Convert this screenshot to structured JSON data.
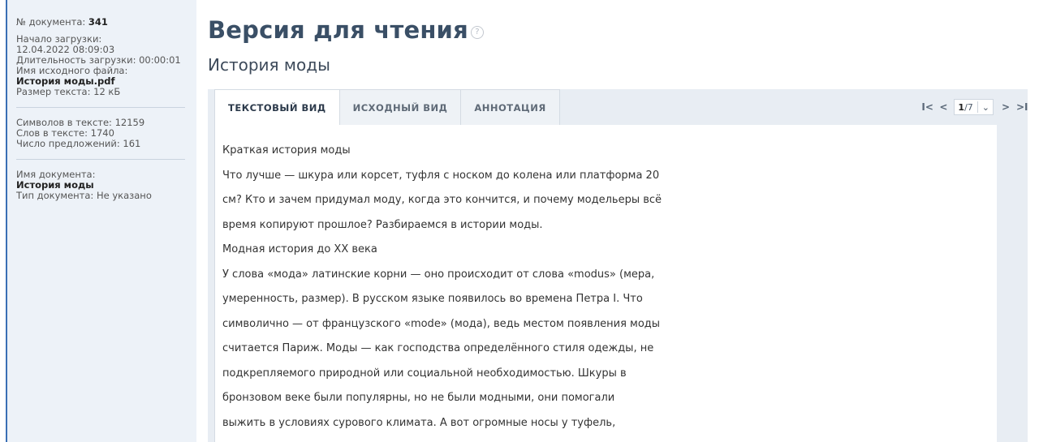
{
  "sidebar": {
    "meta": [
      {
        "label": "№ документа: ",
        "value": "341"
      },
      {
        "label": "Начало загрузки:"
      },
      {
        "label": "12.04.2022 08:09:03"
      },
      {
        "label": "Длительность загрузки: 00:00:01"
      },
      {
        "label": "Имя исходного файла:"
      },
      {
        "value": "История моды.pdf"
      },
      {
        "label": "Размер текста: 12 кБ"
      }
    ],
    "stats": [
      "Символов в тексте: 12159",
      "Слов в тексте: 1740",
      "Число предложений: 161"
    ],
    "doc_info": {
      "name_label": "Имя документа:",
      "name_value": "История моды",
      "type_label": "Тип документа: Не указано"
    }
  },
  "header": {
    "title": "Версия для чтения",
    "help_icon": "?",
    "subtitle": "История моды"
  },
  "tabs": [
    "ТЕКСТОВЫЙ ВИД",
    "ИСХОДНЫЙ ВИД",
    "АННОТАЦИЯ"
  ],
  "pager": {
    "first": "I<",
    "prev": "<",
    "current": "1",
    "total": "/7",
    "dropdown": "⌄",
    "next": ">",
    "last": ">I"
  },
  "content": {
    "lines": [
      "Краткая история моды",
      "Что лучше — шкура или корсет, туфля с носком до колена или платформа 20",
      "см? Кто и зачем придумал моду, когда это кончится, и почему модельеры всё",
      "время копируют прошлое? Разбираемся в истории моды.",
      "Модная история до XX века",
      "У слова «мода» латинские корни — оно происходит от слова «modus» (мера,",
      "умеренность, размер). В русском языке появилось во времена Петра I. Что",
      "символично — от французского «mode» (мода), ведь местом появления моды",
      "считается Париж. Моды — как господства определённого стиля одежды, не",
      "подкрепляемого природной или социальной необходимостью. Шкуры в",
      "бронзовом веке были популярны, но не были модными, они помогали",
      "выжить в условиях сурового климата. А вот огромные носы у туфель,"
    ]
  }
}
